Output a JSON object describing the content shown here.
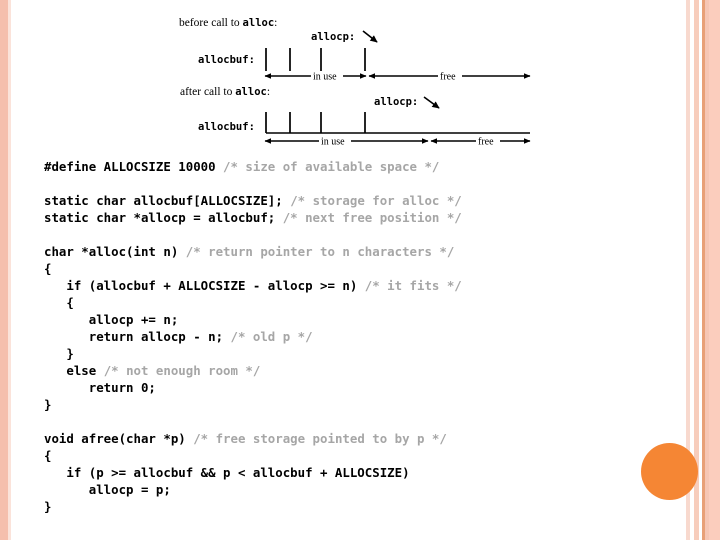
{
  "slide": {
    "background_color": "#ffffff",
    "accent_circle_color": "#f58634",
    "stripe_colors": [
      "#f5bfad",
      "#fbe3da",
      "#f8d9ce",
      "#f7cdbc",
      "#e8a077",
      "#f6c6b4",
      "#fbcdbd"
    ],
    "comment_color": "#a6a6a6",
    "code_color": "#000000"
  },
  "diagram_before": {
    "caption_prefix": "before call to ",
    "caption_mono": "alloc",
    "caption_suffix": ":",
    "buffer_label": "allocbuf:",
    "pointer_label": "allocp:",
    "region_in_use": "in use",
    "region_free": "free"
  },
  "diagram_after": {
    "caption_prefix": "after call to ",
    "caption_mono": "alloc",
    "caption_suffix": ":",
    "buffer_label": "allocbuf:",
    "pointer_label": "allocp:",
    "region_in_use": "in use",
    "region_free": "free"
  },
  "code": {
    "lines": [
      [
        {
          "t": "#define ALLOCSIZE 10000 ",
          "k": "code"
        },
        {
          "t": "/* size of available space */",
          "k": "comment"
        }
      ],
      [],
      [
        {
          "t": "static char allocbuf[ALLOCSIZE]; ",
          "k": "code"
        },
        {
          "t": "/* storage for alloc */",
          "k": "comment"
        }
      ],
      [
        {
          "t": "static char *allocp = allocbuf; ",
          "k": "code"
        },
        {
          "t": "/* next free position */",
          "k": "comment"
        }
      ],
      [],
      [
        {
          "t": "char *alloc(int n) ",
          "k": "code"
        },
        {
          "t": "/* return pointer to n characters */",
          "k": "comment"
        }
      ],
      [
        {
          "t": "{",
          "k": "code"
        }
      ],
      [
        {
          "t": "   if (allocbuf + ALLOCSIZE - allocp >= n) ",
          "k": "code"
        },
        {
          "t": "/* it fits */",
          "k": "comment"
        }
      ],
      [
        {
          "t": "   {",
          "k": "code"
        }
      ],
      [
        {
          "t": "      allocp += n;",
          "k": "code"
        }
      ],
      [
        {
          "t": "      return allocp - n; ",
          "k": "code"
        },
        {
          "t": "/* old p */",
          "k": "comment"
        }
      ],
      [
        {
          "t": "   }",
          "k": "code"
        }
      ],
      [
        {
          "t": "   else ",
          "k": "code"
        },
        {
          "t": "/* not enough room */",
          "k": "comment"
        }
      ],
      [
        {
          "t": "      return 0;",
          "k": "code"
        }
      ],
      [
        {
          "t": "}",
          "k": "code"
        }
      ],
      [],
      [
        {
          "t": "void afree(char *p) ",
          "k": "code"
        },
        {
          "t": "/* free storage pointed to by p */",
          "k": "comment"
        }
      ],
      [
        {
          "t": "{",
          "k": "code"
        }
      ],
      [
        {
          "t": "   if (p >= allocbuf && p < allocbuf + ALLOCSIZE)",
          "k": "code"
        }
      ],
      [
        {
          "t": "      allocp = p;",
          "k": "code"
        }
      ],
      [
        {
          "t": "}",
          "k": "code"
        }
      ]
    ]
  }
}
